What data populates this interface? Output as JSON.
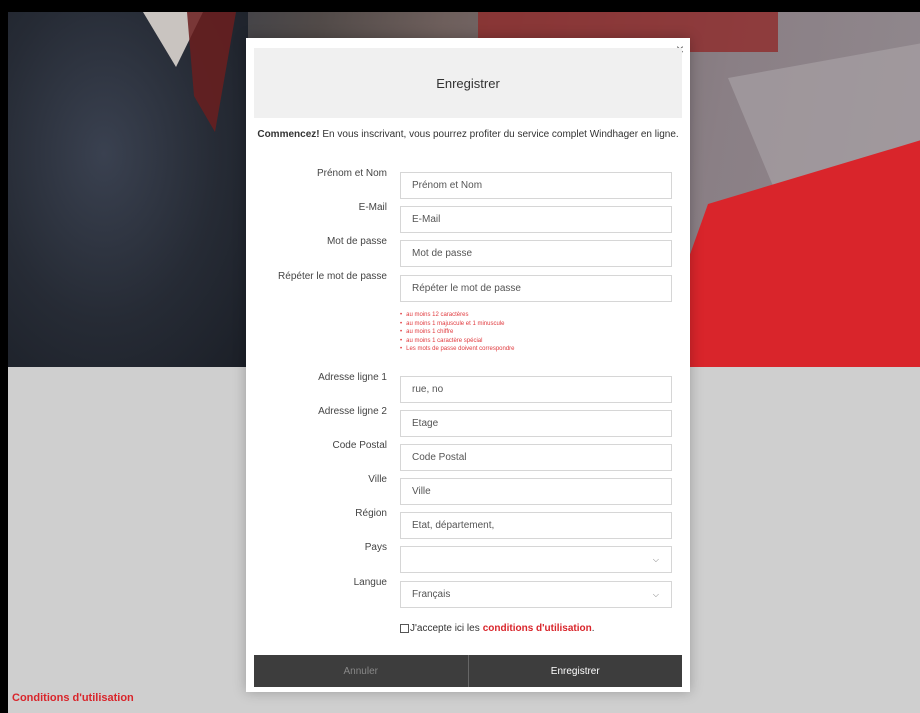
{
  "modal": {
    "title": "Enregistrer",
    "close_glyph": "×",
    "intro_bold": "Commencez!",
    "intro_text": " En vous inscrivant, vous pourrez profiter du service complet Windhager en ligne."
  },
  "fields": [
    {
      "label": "Prénom et Nom",
      "placeholder": "Prénom et Nom"
    },
    {
      "label": "E-Mail",
      "placeholder": "E-Mail"
    },
    {
      "label": "Mot de passe",
      "placeholder": "Mot de passe"
    },
    {
      "label": "Répéter le mot de passe",
      "placeholder": "Répéter le mot de passe"
    },
    {
      "label": "Adresse ligne 1",
      "placeholder": "rue, no"
    },
    {
      "label": "Adresse ligne 2",
      "placeholder": "Etage"
    },
    {
      "label": "Code Postal",
      "placeholder": "Code Postal"
    },
    {
      "label": "Ville",
      "placeholder": "Ville"
    },
    {
      "label": "Région",
      "placeholder": "Etat, département,"
    },
    {
      "label": "Pays",
      "value": ""
    },
    {
      "label": "Langue",
      "value": "Français"
    }
  ],
  "password_rules": [
    "au moins 12 caractères",
    "au moins 1 majuscule et 1 minuscule",
    "au moins 1 chiffre",
    "au moins 1 caractère spécial",
    "Les mots de passe doivent correspondre"
  ],
  "terms": {
    "prefix": "J'accepte ici les",
    "link": "conditions d'utilisation",
    "suffix": "."
  },
  "buttons": {
    "cancel": "Annuler",
    "submit": "Enregistrer"
  },
  "footer": {
    "link": "Conditions d'utilisation"
  },
  "icons": {
    "chevron": "chevron-down-icon",
    "close": "close-icon",
    "checkbox": "checkbox-icon"
  },
  "colors": {
    "accent": "#d9252b",
    "button_bar": "#3d3d3d",
    "rule_text": "#e03a3e"
  }
}
